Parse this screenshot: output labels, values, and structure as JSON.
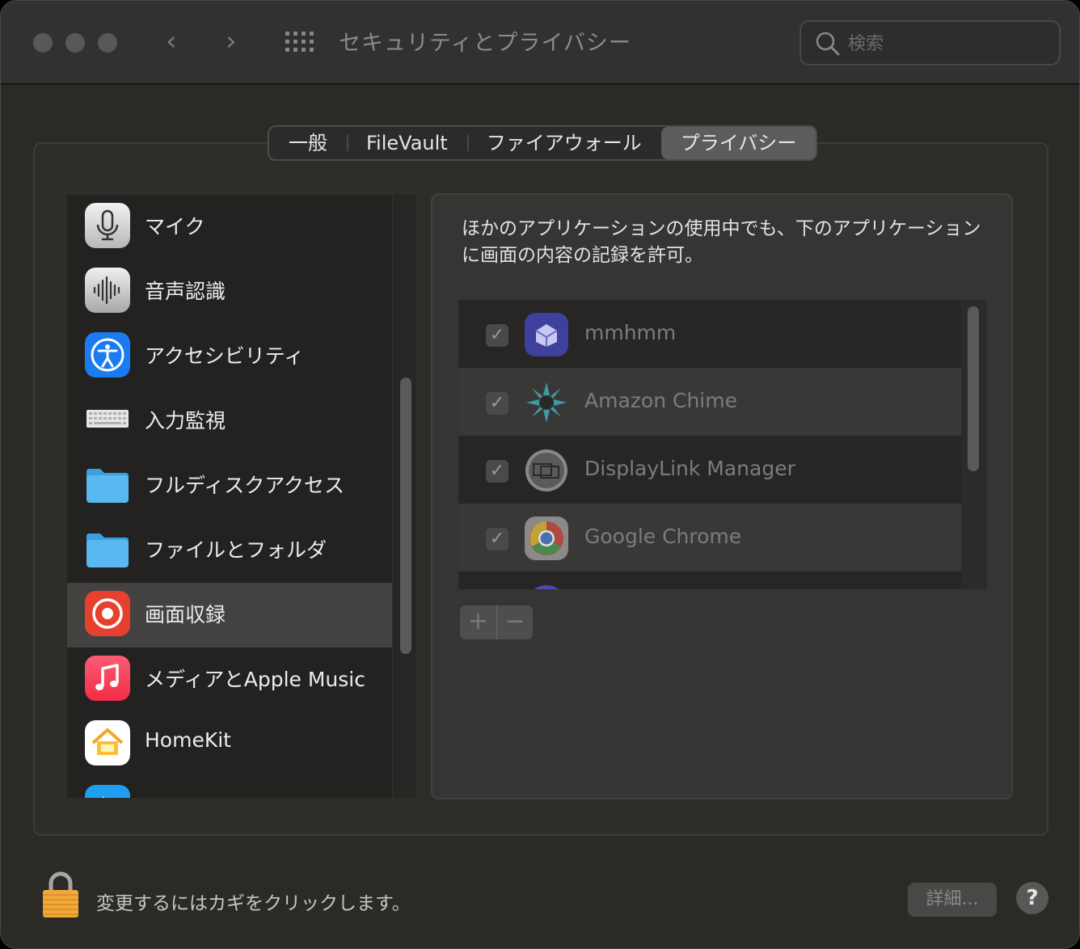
{
  "window": {
    "title": "セキュリティとプライバシー",
    "back_icon": "‹",
    "forward_icon": "›"
  },
  "search": {
    "placeholder": "検索",
    "value": ""
  },
  "tabs": [
    {
      "label": "一般",
      "active": false
    },
    {
      "label": "FileVault",
      "active": false
    },
    {
      "label": "ファイアウォール",
      "active": false
    },
    {
      "label": "プライバシー",
      "active": true
    }
  ],
  "sidebar": {
    "items": [
      {
        "label": "マイク",
        "icon": "microphone-icon"
      },
      {
        "label": "音声認識",
        "icon": "speech-recognition-icon"
      },
      {
        "label": "アクセシビリティ",
        "icon": "accessibility-icon"
      },
      {
        "label": "入力監視",
        "icon": "keyboard-icon"
      },
      {
        "label": "フルディスクアクセス",
        "icon": "folder-icon"
      },
      {
        "label": "ファイルとフォルダ",
        "icon": "folder-icon"
      },
      {
        "label": "画面収録",
        "icon": "screen-recording-icon",
        "selected": true
      },
      {
        "label": "メディアとApple Music",
        "icon": "music-icon"
      },
      {
        "label": "HomeKit",
        "icon": "home-icon"
      }
    ]
  },
  "panel": {
    "description": "ほかのアプリケーションの使用中でも、下のアプリケーションに画面の内容の記録を許可。",
    "apps": [
      {
        "name": "mmhmm",
        "checked": true,
        "icon": "mmhmm-icon"
      },
      {
        "name": "Amazon Chime",
        "checked": true,
        "icon": "amazon-chime-icon"
      },
      {
        "name": "DisplayLink Manager",
        "checked": true,
        "icon": "displaylink-icon"
      },
      {
        "name": "Google Chrome",
        "checked": true,
        "icon": "chrome-icon"
      }
    ],
    "add_label": "+",
    "remove_label": "−"
  },
  "footer": {
    "lock_text": "変更するにはカギをクリックします。",
    "details_label": "詳細...",
    "help_label": "?"
  },
  "colors": {
    "window_bg": "#2c2a27",
    "selected_row": "#444240",
    "screen_recording_red": "#e8402f",
    "accessibility_blue": "#1a7cf0",
    "folder_blue": "#5ab8f0"
  }
}
